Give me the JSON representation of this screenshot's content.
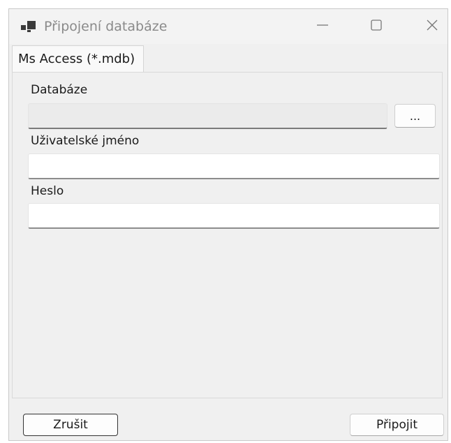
{
  "window": {
    "title": "Připojení databáze",
    "icon": "app-window-icon",
    "controls": {
      "minimize": "minimize-icon",
      "maximize": "maximize-icon",
      "close": "close-icon"
    }
  },
  "tabs": [
    {
      "label": "Ms Access (*.mdb)",
      "active": true
    }
  ],
  "form": {
    "database": {
      "label": "Databáze",
      "value": "",
      "placeholder": "",
      "browse_label": "..."
    },
    "username": {
      "label": "Uživatelské jméno",
      "value": "",
      "placeholder": ""
    },
    "password": {
      "label": "Heslo",
      "value": "",
      "placeholder": ""
    }
  },
  "footer": {
    "cancel_label": "Zrušit",
    "connect_label": "Připojit"
  },
  "colors": {
    "window_bg": "#f0f0f0",
    "title_text": "#8a8a8a",
    "input_underline": "#8c8c8c"
  }
}
